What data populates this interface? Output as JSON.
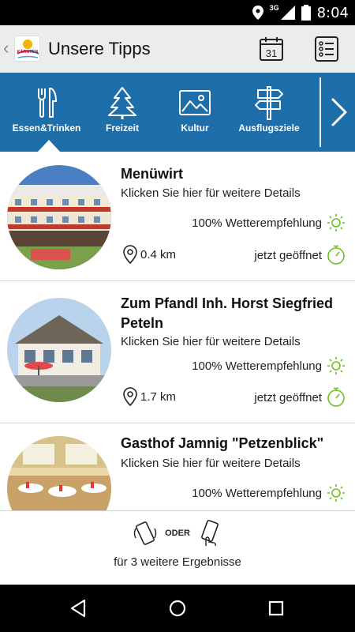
{
  "status_bar": {
    "network": "3G",
    "time": "8:04",
    "icons": [
      "location-icon",
      "signal-icon",
      "battery-icon"
    ]
  },
  "app_bar": {
    "title": "Unsere Tipps",
    "calendar_day": "31",
    "logo_text": "KÄRNTEN"
  },
  "categories": [
    {
      "label": "Essen&Trinken",
      "icon": "fork-knife-icon",
      "selected": true
    },
    {
      "label": "Freizeit",
      "icon": "tree-icon",
      "selected": false
    },
    {
      "label": "Kultur",
      "icon": "picture-icon",
      "selected": false
    },
    {
      "label": "Ausflugsziele",
      "icon": "signpost-icon",
      "selected": false
    }
  ],
  "items": [
    {
      "name": "Menüwirt",
      "details": "Klicken Sie hier für weitere Details",
      "weather": "100% Wetterempfehlung",
      "distance": "0.4 km",
      "open_status": "jetzt geöffnet"
    },
    {
      "name": "Zum Pfandl Inh. Horst Siegfried Peteln",
      "details": "Klicken Sie hier für weitere Details",
      "weather": "100% Wetterempfehlung",
      "distance": "1.7 km",
      "open_status": "jetzt geöffnet"
    },
    {
      "name": "Gasthof Jamnig \"Petzenblick\"",
      "details": "Klicken Sie hier für weitere Details",
      "weather": "100% Wetterempfehlung"
    }
  ],
  "footer": {
    "separator": "ODER",
    "more_results": "für 3 weitere Ergebnisse"
  },
  "colors": {
    "accent_blue": "#1e6fa9",
    "green": "#6cc21e"
  }
}
